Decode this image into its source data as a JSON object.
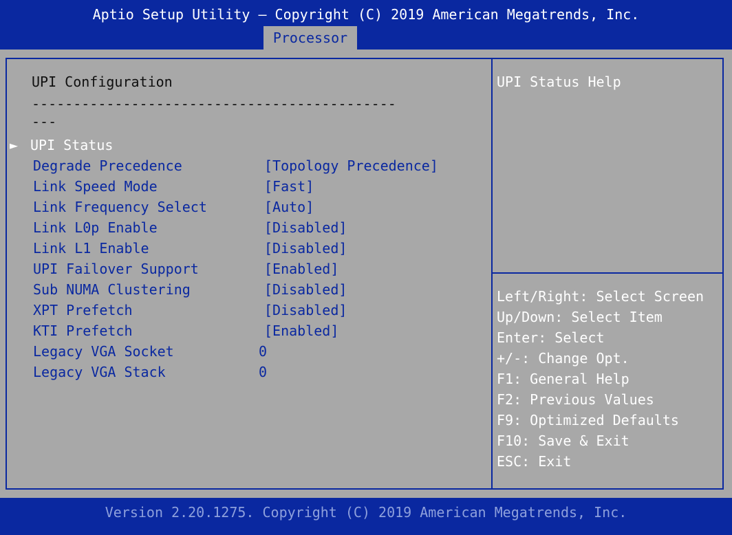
{
  "header": {
    "title": "Aptio Setup Utility – Copyright (C) 2019 American Megatrends, Inc.",
    "active_tab": "Processor"
  },
  "main": {
    "section_title": "UPI Configuration",
    "separator_line1": "--------------------------------------------",
    "separator_line2": "---",
    "selected_item": "UPI Status",
    "settings": [
      {
        "label": "Degrade Precedence",
        "value": "[Topology Precedence]"
      },
      {
        "label": "Link Speed Mode",
        "value": "[Fast]"
      },
      {
        "label": "Link Frequency Select",
        "value": "[Auto]"
      },
      {
        "label": "Link L0p Enable",
        "value": "[Disabled]"
      },
      {
        "label": "Link L1 Enable",
        "value": "[Disabled]"
      },
      {
        "label": "UPI Failover Support",
        "value": "[Enabled]"
      },
      {
        "label": "Sub NUMA Clustering",
        "value": "[Disabled]"
      },
      {
        "label": "XPT Prefetch",
        "value": "[Disabled]"
      },
      {
        "label": "KTI Prefetch",
        "value": "[Enabled]"
      }
    ],
    "info": [
      {
        "label": "Legacy VGA Socket",
        "value": "0"
      },
      {
        "label": "Legacy VGA Stack",
        "value": "0"
      }
    ]
  },
  "help": {
    "description": "UPI Status Help",
    "keys": [
      "Left/Right: Select Screen",
      "Up/Down: Select Item",
      "Enter: Select",
      "+/-: Change Opt.",
      "F1: General Help",
      "F2: Previous Values",
      "F9: Optimized Defaults",
      "F10: Save & Exit",
      "ESC: Exit"
    ]
  },
  "footer": {
    "version": "Version 2.20.1275. Copyright (C) 2019 American Megatrends, Inc."
  },
  "colors": {
    "header_blue": "#0a28a0",
    "panel_gray": "#a8a8a8",
    "selected_text": "#ffffff",
    "label_text": "#0a28a0",
    "footer_text": "#8ea0dc"
  }
}
